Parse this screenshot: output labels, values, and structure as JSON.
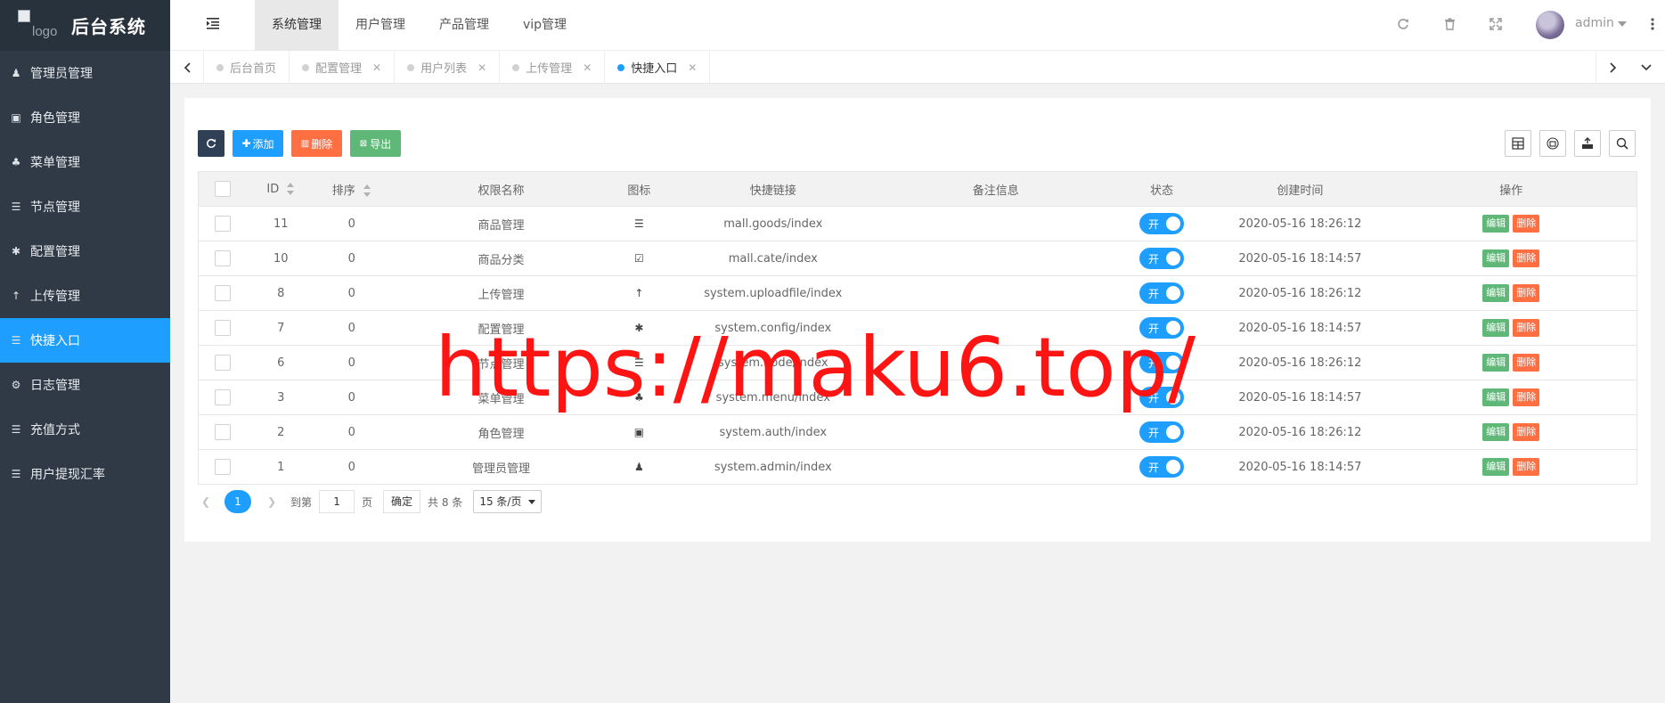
{
  "sidebar": {
    "logo_alt": "logo",
    "title": "后台系统",
    "items": [
      {
        "label": "管理员管理",
        "icon": "user-icon",
        "glyph": "♟",
        "active": false
      },
      {
        "label": "角色管理",
        "icon": "id-card-icon",
        "glyph": "▣",
        "active": false
      },
      {
        "label": "菜单管理",
        "icon": "tree-icon",
        "glyph": "♣",
        "active": false
      },
      {
        "label": "节点管理",
        "icon": "list-icon",
        "glyph": "☰",
        "active": false
      },
      {
        "label": "配置管理",
        "icon": "asterisk-icon",
        "glyph": "✱",
        "active": false
      },
      {
        "label": "上传管理",
        "icon": "arrow-up-icon",
        "glyph": "↑",
        "active": false
      },
      {
        "label": "快捷入口",
        "icon": "list-icon",
        "glyph": "☰",
        "active": true
      },
      {
        "label": "日志管理",
        "icon": "gear-icon",
        "glyph": "⚙",
        "active": false
      },
      {
        "label": "充值方式",
        "icon": "list-icon",
        "glyph": "☰",
        "active": false
      },
      {
        "label": "用户提现汇率",
        "icon": "list-icon",
        "glyph": "☰",
        "active": false
      }
    ]
  },
  "header": {
    "nav": [
      "系统管理",
      "用户管理",
      "产品管理",
      "vip管理"
    ],
    "active_nav": 0,
    "admin_name": "admin"
  },
  "tabs": [
    {
      "label": "后台首页",
      "closable": false,
      "active": false
    },
    {
      "label": "配置管理",
      "closable": true,
      "active": false
    },
    {
      "label": "用户列表",
      "closable": true,
      "active": false
    },
    {
      "label": "上传管理",
      "closable": true,
      "active": false
    },
    {
      "label": "快捷入口",
      "closable": true,
      "active": true
    }
  ],
  "toolbar": {
    "refresh_icon": "refresh-icon",
    "add_label": "添加",
    "delete_label": "删除",
    "export_label": "导出"
  },
  "table": {
    "columns": [
      "ID",
      "排序",
      "权限名称",
      "图标",
      "快捷链接",
      "备注信息",
      "状态",
      "创建时间",
      "操作"
    ],
    "rows": [
      {
        "id": "11",
        "sort": "0",
        "name": "商品管理",
        "icon": "list-icon",
        "glyph": "☰",
        "link": "mall.goods/index",
        "remark": "",
        "status": "开",
        "created": "2020-05-16 18:26:12"
      },
      {
        "id": "10",
        "sort": "0",
        "name": "商品分类",
        "icon": "calendar-check-icon",
        "glyph": "☑",
        "link": "mall.cate/index",
        "remark": "",
        "status": "开",
        "created": "2020-05-16 18:14:57"
      },
      {
        "id": "8",
        "sort": "0",
        "name": "上传管理",
        "icon": "arrow-up-icon",
        "glyph": "↑",
        "link": "system.uploadfile/index",
        "remark": "",
        "status": "开",
        "created": "2020-05-16 18:26:12"
      },
      {
        "id": "7",
        "sort": "0",
        "name": "配置管理",
        "icon": "asterisk-icon",
        "glyph": "✱",
        "link": "system.config/index",
        "remark": "",
        "status": "开",
        "created": "2020-05-16 18:14:57"
      },
      {
        "id": "6",
        "sort": "0",
        "name": "节点管理",
        "icon": "list-icon",
        "glyph": "☰",
        "link": "system.node/index",
        "remark": "",
        "status": "开",
        "created": "2020-05-16 18:26:12"
      },
      {
        "id": "3",
        "sort": "0",
        "name": "菜单管理",
        "icon": "tree-icon",
        "glyph": "♣",
        "link": "system.menu/index",
        "remark": "",
        "status": "开",
        "created": "2020-05-16 18:14:57"
      },
      {
        "id": "2",
        "sort": "0",
        "name": "角色管理",
        "icon": "id-card-icon",
        "glyph": "▣",
        "link": "system.auth/index",
        "remark": "",
        "status": "开",
        "created": "2020-05-16 18:26:12"
      },
      {
        "id": "1",
        "sort": "0",
        "name": "管理员管理",
        "icon": "user-icon",
        "glyph": "♟",
        "link": "system.admin/index",
        "remark": "",
        "status": "开",
        "created": "2020-05-16 18:14:57"
      }
    ],
    "edit_label": "编辑",
    "delete_label": "删除"
  },
  "pager": {
    "current": "1",
    "goto_label": "到第",
    "page_input": "1",
    "page_suffix": "页",
    "confirm_label": "确定",
    "total_label": "共 8 条",
    "page_size": "15 条/页"
  },
  "watermark": "https://maku6.top/",
  "colors": {
    "sidebar_bg": "#2f3a46",
    "accent": "#1e9fff",
    "edit": "#5fb878",
    "delete": "#ff5722",
    "watermark": "#ff1414"
  }
}
